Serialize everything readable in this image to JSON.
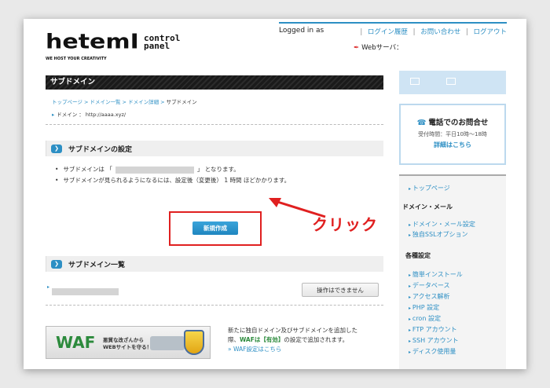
{
  "header": {
    "logo_main": "hetemI",
    "logo_sub": "control panel",
    "logo_tag": "WE HOST YOUR CREATIVITY",
    "logged_in": "Logged in as",
    "links": [
      "ログイン履歴",
      "お問い合わせ",
      "ログアウト"
    ],
    "server_label": "Webサーバ："
  },
  "main": {
    "page_title": "サブドメイン",
    "breadcrumb": [
      "トップページ",
      "ドメイン一覧",
      "ドメイン詳細",
      "サブドメイン"
    ],
    "domain_label": "ドメイン ： http://aaaa.xyz/",
    "settings_title": "サブドメインの設定",
    "bullet1_pre": "サブドメインは 「",
    "bullet1_post": "」 となります。",
    "bullet2": "サブドメインが見られるようになるには、設定後（変更後） 1 時間 ほどかかります。",
    "new_button": "新規作成",
    "list_title": "サブドメイン一覧",
    "op_button": "操作はできません",
    "waf_logo": "WAF",
    "waf_text1": "悪質な改ざんから",
    "waf_text2": "WEBサイトを守る！",
    "waf_desc1": "新たに独自ドメイン及びサブドメインを追加した",
    "waf_desc2_pre": "際、",
    "waf_desc2_green": "WAFは【有効】",
    "waf_desc2_post": "の設定で追加されます。",
    "waf_link": "» WAF設定はこちら"
  },
  "sidebar": {
    "contact_title": "電話でのお問合せ",
    "contact_hours": "受付時間：平日10時〜18時",
    "contact_link": "詳細はこちら",
    "nav_top": "トップページ",
    "head_domain": "ドメイン・メール",
    "nav_domain_mail": "ドメイン・メール設定",
    "nav_ssl": "独自SSLオプション",
    "head_settings": "各種設定",
    "nav_install": "簡単インストール",
    "nav_db": "データベース",
    "nav_access": "アクセス解析",
    "nav_php": "PHP 設定",
    "nav_cron": "cron 設定",
    "nav_ftp": "FTP アカウント",
    "nav_ssh": "SSH アカウント",
    "nav_disk": "ディスク使用量"
  },
  "annotation": {
    "click_label": "クリック",
    "color": "#e02020"
  },
  "colors": {
    "accent": "#2d8fc4",
    "title_bar": "#1a1a1a"
  }
}
